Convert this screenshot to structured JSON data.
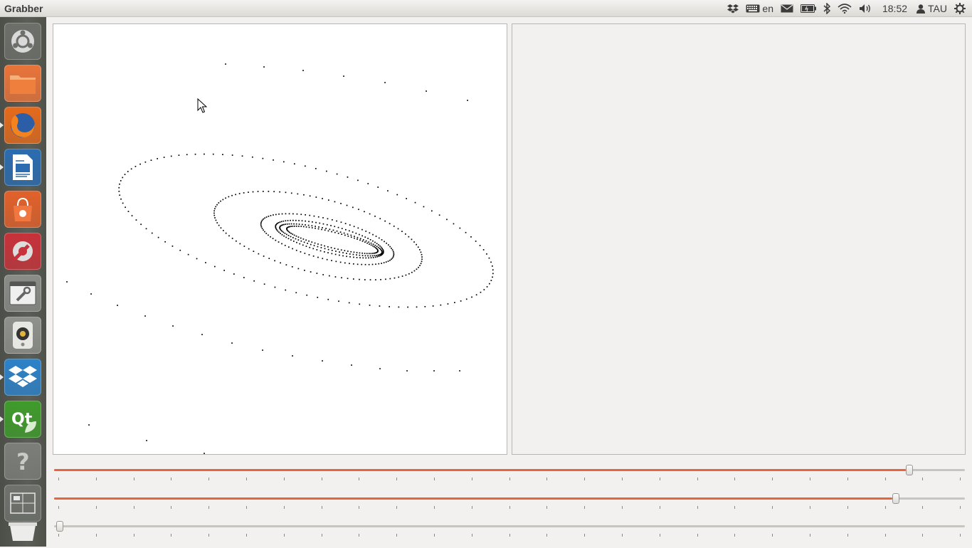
{
  "window": {
    "title": "Grabber"
  },
  "panel": {
    "keyboard_layout": "en",
    "clock": "18:52",
    "user": "TAU",
    "indicators": [
      "dropbox-icon",
      "keyboard-icon",
      "mail-icon",
      "battery-icon",
      "bluetooth-icon",
      "wifi-icon",
      "volume-icon",
      "session-gear-icon"
    ]
  },
  "launcher": {
    "items": [
      {
        "name": "dash-home",
        "color": "#6d6f6a"
      },
      {
        "name": "files",
        "color": "#e9743a"
      },
      {
        "name": "firefox",
        "color": "#e56a1c"
      },
      {
        "name": "libreoffice-writer",
        "color": "#2b6cb0"
      },
      {
        "name": "ubuntu-software-center",
        "color": "#e2612b"
      },
      {
        "name": "system-settings",
        "color": "#c8323a"
      },
      {
        "name": "window-tool",
        "color": "#8a8d88"
      },
      {
        "name": "speaker-app",
        "color": "#8f918c"
      },
      {
        "name": "dropbox",
        "color": "#2d82c9"
      },
      {
        "name": "qt-creator",
        "color": "#3f9b2c"
      },
      {
        "name": "help",
        "color": "#7c7e7a"
      },
      {
        "name": "workspace-switcher",
        "color": "#6f726d"
      },
      {
        "name": "trash",
        "color": "#7a7c78"
      }
    ]
  },
  "sliders": [
    {
      "name": "slider-1",
      "value_fraction": 0.94
    },
    {
      "name": "slider-2",
      "value_fraction": 0.925
    },
    {
      "name": "slider-3",
      "value_fraction": 0.0
    }
  ],
  "colors": {
    "accent": "#e7643c",
    "plot_bg": "#ffffff",
    "dots": "#000000"
  }
}
